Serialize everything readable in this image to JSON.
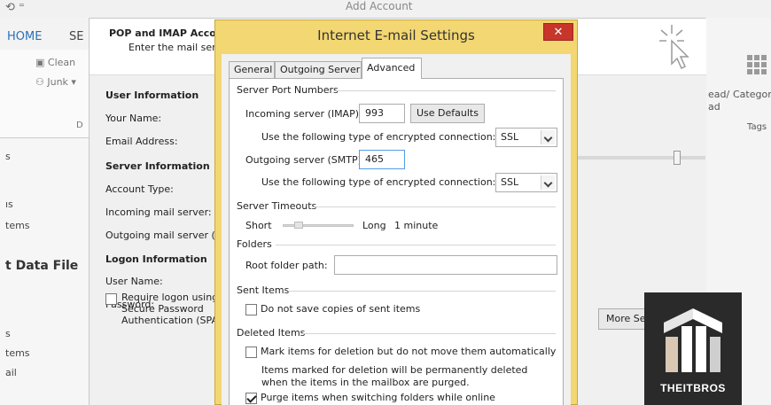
{
  "outlook": {
    "quick_access": "⟲ ⁼",
    "window_title": "Add Account",
    "tab_home": "HOME",
    "tab_se": "SE",
    "ribbon_clean": "Clean",
    "ribbon_junk": "Junk ▾",
    "ribbon_group_d": "D",
    "left_labels": [
      "s",
      "ıs",
      "tems",
      "s",
      "tems",
      "ail"
    ],
    "left_data_file": "t Data File",
    "right_read": "ead/",
    "right_read2": "ad",
    "right_category": "Categor",
    "right_tags": "Tags"
  },
  "wizard": {
    "header_title": "POP and IMAP Account Settings",
    "header_subtitle": "Enter the mail server settings for your account.",
    "labels": {
      "user_info": "User Information",
      "your_name": "Your Name:",
      "email": "Email Address:",
      "server_info": "Server Information",
      "account_type": "Account Type:",
      "incoming": "Incoming mail server:",
      "outgoing": "Outgoing mail server (SMTP):",
      "logon_info": "Logon Information",
      "user_name": "User Name:",
      "password": "Password:"
    },
    "spa_label": "Require logon using Secure Password Authentication (SPA)",
    "more_settings": "More Settings ..."
  },
  "dialog": {
    "title": "Internet E-mail Settings",
    "close_glyph": "✕",
    "tabs": [
      "General",
      "Outgoing Server",
      "Advanced"
    ],
    "active_tab": "Advanced",
    "server_ports": {
      "group": "Server Port Numbers",
      "incoming_label": "Incoming server (IMAP):",
      "incoming_value": "993",
      "use_defaults": "Use Defaults",
      "encryption_label": "Use the following type of encrypted connection:",
      "incoming_encryption": "SSL",
      "outgoing_label": "Outgoing server (SMTP):",
      "outgoing_value": "465",
      "outgoing_encryption": "SSL"
    },
    "timeouts": {
      "group": "Server Timeouts",
      "short": "Short",
      "long": "Long",
      "value": "1 minute",
      "level": 0.18
    },
    "folders": {
      "group": "Folders",
      "root_label": "Root folder path:",
      "root_value": ""
    },
    "sent_items": {
      "group": "Sent Items",
      "no_copies": "Do not save copies of sent items",
      "no_copies_checked": false
    },
    "deleted_items": {
      "group": "Deleted Items",
      "mark_label": "Mark items for deletion but do not move them automatically",
      "mark_checked": false,
      "note": "Items marked for deletion will be permanently deleted when the items in the mailbox are purged.",
      "purge_label": "Purge items when switching folders while online",
      "purge_checked": true
    }
  },
  "watermark": {
    "brand": "THEITBROS"
  }
}
